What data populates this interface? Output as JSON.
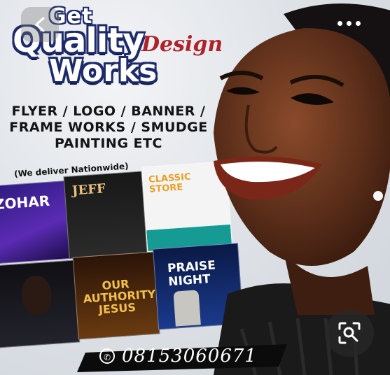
{
  "poster": {
    "headline_get": "Get",
    "headline_quality": "Quality",
    "headline_design": "Design",
    "headline_works": "Works",
    "services": [
      "FLYER / LOGO / BANNER /",
      "FRAME WORKS / SMUDGE",
      "PAINTING ETC"
    ],
    "delivery_note": "(We deliver Nationwide)",
    "phone": "08153060671"
  },
  "flyers": {
    "zohar": "ZOHAR",
    "jeff": "JEFF",
    "classic_store": "CLASSIC STORE",
    "authority": "OUR AUTHORITY JESUS",
    "praise": "PRAISE NIGHT"
  },
  "controls": {
    "back_icon": "chevron-left-icon",
    "more_icon": "more-horizontal-icon",
    "lens_icon": "visual-search-icon"
  },
  "colors": {
    "brand_navy": "#1d2a6b",
    "accent_red": "#b0222a"
  }
}
